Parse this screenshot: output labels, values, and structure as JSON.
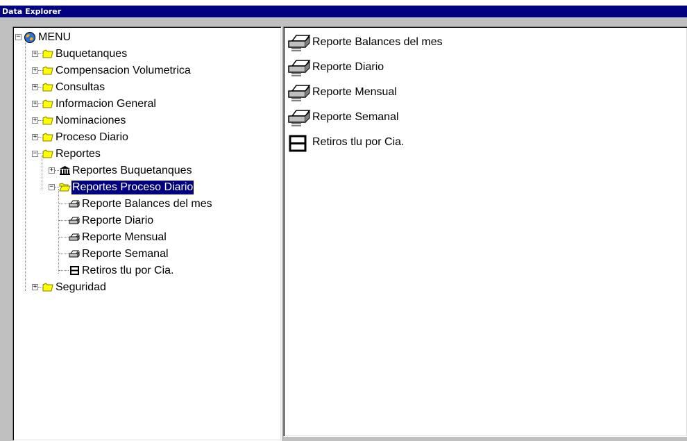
{
  "window": {
    "title": "Data Explorer"
  },
  "tree": {
    "root": {
      "label": "MENU",
      "icon": "globe-icon"
    },
    "folders": [
      {
        "label": "Buquetanques",
        "icon": "folder-closed-icon"
      },
      {
        "label": "Compensacion Volumetrica",
        "icon": "folder-closed-icon"
      },
      {
        "label": "Consultas",
        "icon": "folder-closed-icon"
      },
      {
        "label": "Informacion General",
        "icon": "folder-closed-icon"
      },
      {
        "label": "Nominaciones",
        "icon": "folder-closed-icon"
      },
      {
        "label": "Proceso Diario",
        "icon": "folder-closed-icon"
      },
      {
        "label": "Reportes",
        "icon": "folder-closed-icon"
      }
    ],
    "reportes_children": [
      {
        "label": "Reportes Buquetanques",
        "icon": "bank-icon"
      },
      {
        "label": "Reportes Proceso Diario",
        "icon": "folder-open-icon",
        "selected": true
      }
    ],
    "proceso_diario_children": [
      {
        "label": "Reporte Balances del mes",
        "icon": "printer-icon"
      },
      {
        "label": "Reporte Diario",
        "icon": "printer-icon"
      },
      {
        "label": "Reporte Mensual",
        "icon": "printer-icon"
      },
      {
        "label": "Reporte Semanal",
        "icon": "printer-icon"
      },
      {
        "label": "Retiros tlu por Cia.",
        "icon": "table-icon"
      }
    ],
    "last": {
      "label": "Seguridad",
      "icon": "folder-closed-icon"
    }
  },
  "list": {
    "items": [
      {
        "label": "Reporte Balances del mes",
        "icon": "printer-icon"
      },
      {
        "label": "Reporte Diario",
        "icon": "printer-icon"
      },
      {
        "label": "Reporte Mensual",
        "icon": "printer-icon"
      },
      {
        "label": "Reporte Semanal",
        "icon": "printer-icon"
      },
      {
        "label": "Retiros tlu por Cia.",
        "icon": "table-icon"
      }
    ]
  },
  "colors": {
    "titlebar": "#000080",
    "selection": "#000080",
    "folder": "#ffff00",
    "frame": "#c0c0c0"
  }
}
